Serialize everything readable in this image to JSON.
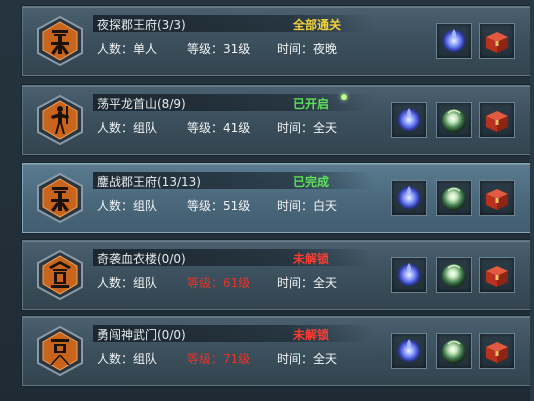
{
  "colors": {
    "gold_status": "#f0d23a",
    "green_status": "#5ee05a",
    "red_status": "#ff3c30",
    "emblem_orange": "#c8641c"
  },
  "dungeons": [
    {
      "title": "夜探郡王府(3/3)",
      "status": "全部通关",
      "status_color": "gold",
      "people": "人数：单人",
      "level": "等级：31级",
      "time": "时间：夜晚",
      "level_locked": false,
      "icons": [
        "blue-orb-icon",
        "red-chest-icon"
      ]
    },
    {
      "title": "荡平龙首山(8/9)",
      "status": "已开启",
      "status_color": "green",
      "people": "人数：组队",
      "level": "等级：41级",
      "time": "时间：全天",
      "level_locked": false,
      "icons": [
        "blue-orb-icon",
        "green-orb-icon",
        "red-chest-icon"
      ]
    },
    {
      "title": "鏖战郡王府(13/13)",
      "status": "已完成",
      "status_color": "green",
      "people": "人数：组队",
      "level": "等级：51级",
      "time": "时间：白天",
      "level_locked": false,
      "icons": [
        "blue-orb-icon",
        "green-orb-icon",
        "red-chest-icon"
      ]
    },
    {
      "title": "奇袭血衣楼(0/0)",
      "status": "未解锁",
      "status_color": "red",
      "people": "人数：组队",
      "level": "等级：61级",
      "time": "时间：全天",
      "level_locked": true,
      "icons": [
        "blue-orb-icon",
        "green-orb-icon",
        "red-chest-icon"
      ]
    },
    {
      "title": "勇闯神武门(0/0)",
      "status": "未解锁",
      "status_color": "red",
      "people": "人数：组队",
      "level": "等级：71级",
      "time": "时间：全天",
      "level_locked": true,
      "icons": [
        "blue-orb-icon",
        "green-orb-icon",
        "red-chest-icon"
      ]
    }
  ]
}
